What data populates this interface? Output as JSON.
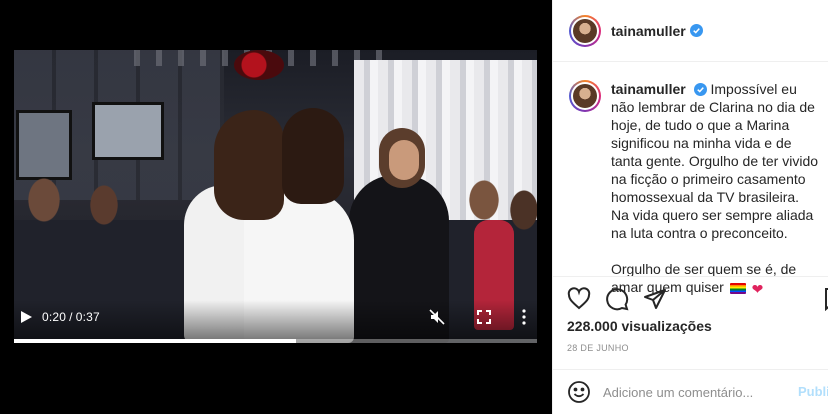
{
  "video": {
    "current_time": "0:20",
    "separator": "/",
    "duration": "0:37",
    "progress": 0.54
  },
  "post": {
    "username": "tainamuller",
    "caption_p1": "Impossível eu não lembrar de Clarina no dia de hoje, de tudo o que a Marina significou na minha vida e de tanta gente. Orgulho de ter vivido na ficção o primeiro casamento homossexual da TV brasileira. Na vida quero ser sempre aliada na luta contra o preconceito.",
    "caption_p2": "Orgulho de ser quem se é, de amar quem quiser",
    "heart_glyph": "❤",
    "views": "228.000 visualizações",
    "date": "28 DE JUNHO"
  },
  "comment": {
    "placeholder": "Adicione um comentário...",
    "publish_label": "Publi"
  },
  "colors": {
    "verified": "#3897f0",
    "publish": "#b2dffc",
    "heart": "#e0245e"
  },
  "icons": [
    "play-icon",
    "muted-icon",
    "fullscreen-icon",
    "more-icon",
    "verified-icon",
    "heart-icon",
    "comment-icon",
    "share-icon",
    "save-icon",
    "emoji-icon"
  ]
}
